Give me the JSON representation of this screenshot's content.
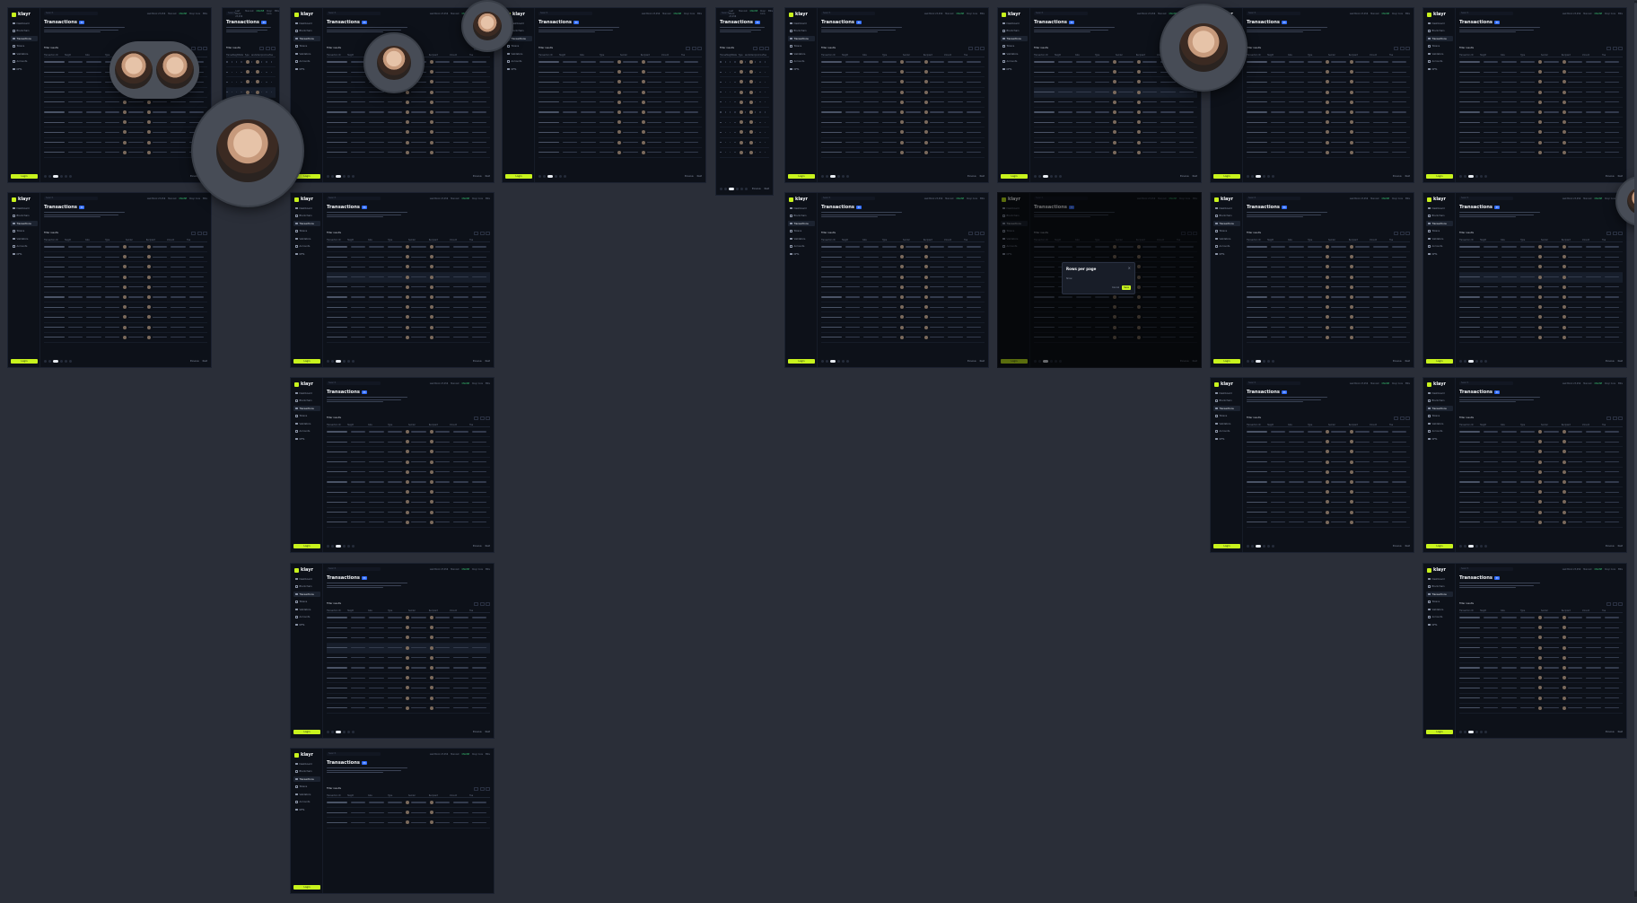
{
  "app": {
    "brand": "klayr",
    "page_title": "Transactions",
    "badge": "33",
    "search_placeholder": "Search",
    "status_items": [
      "Last Block 23,456",
      "Mainnet",
      "ONLINE",
      "Klayr Core",
      "ENG"
    ],
    "nav_items": [
      "Dashboard",
      "Blockchain",
      "Transactions",
      "Tokens",
      "Validators",
      "Accounts",
      "NFTs"
    ],
    "login_label": "Login",
    "filter_label": "Filter results",
    "table_headers": [
      "Transaction ID",
      "Height",
      "Date",
      "Type",
      "Sender",
      "Recipient",
      "Amount",
      "Fee"
    ],
    "pager_prev": "Previous",
    "pager_next": "Next"
  },
  "modal": {
    "title": "Rows per page",
    "subtitle": "Show",
    "cancel": "Cancel",
    "save": "Save",
    "close": "×"
  }
}
